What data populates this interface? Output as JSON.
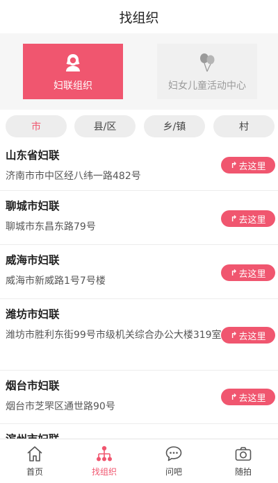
{
  "header": {
    "title": "找组织"
  },
  "categories": [
    {
      "label": "妇联组织",
      "icon": "woman-icon",
      "active": true
    },
    {
      "label": "妇女儿童活动中心",
      "icon": "balloon-icon",
      "active": false
    }
  ],
  "filters": [
    {
      "label": "市",
      "active": true
    },
    {
      "label": "县/区",
      "active": false
    },
    {
      "label": "乡/镇",
      "active": false
    },
    {
      "label": "村",
      "active": false
    }
  ],
  "goto_label": "去这里",
  "organizations": [
    {
      "name": "山东省妇联",
      "address": "济南市市中区经八纬一路482号"
    },
    {
      "name": "聊城市妇联",
      "address": "聊城市东昌东路79号"
    },
    {
      "name": "威海市妇联",
      "address": "威海市新威路1号7号楼"
    },
    {
      "name": "潍坊市妇联",
      "address": "潍坊市胜利东街99号市级机关综合办公大楼319室"
    },
    {
      "name": "烟台市妇联",
      "address": "烟台市芝罘区通世路90号"
    },
    {
      "name": "滨州市妇联",
      "address": ""
    }
  ],
  "tabbar": [
    {
      "label": "首页",
      "icon": "home-icon",
      "active": false
    },
    {
      "label": "找组织",
      "icon": "org-tree-icon",
      "active": true
    },
    {
      "label": "问吧",
      "icon": "chat-bubble-icon",
      "active": false
    },
    {
      "label": "随拍",
      "icon": "camera-icon",
      "active": false
    }
  ],
  "colors": {
    "accent": "#f0566f",
    "chip_bg": "#ededed",
    "card_inactive": "#f0f0f0"
  }
}
